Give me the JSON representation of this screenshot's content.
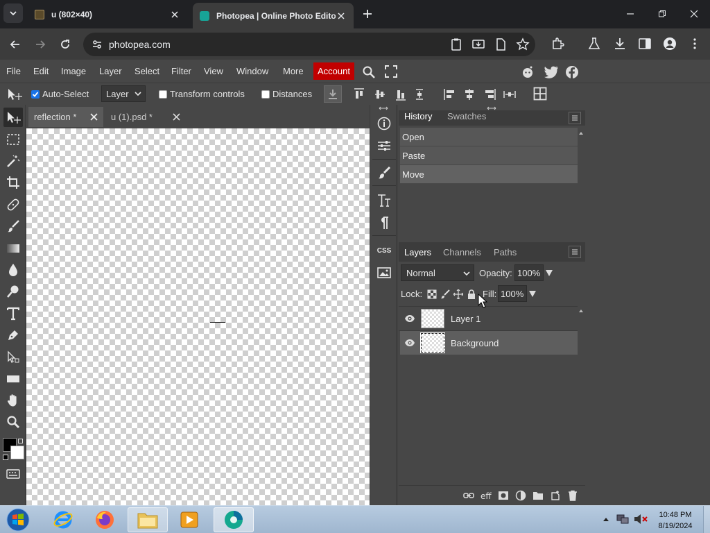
{
  "browser": {
    "tabs": [
      {
        "title": "u (802×40)",
        "active": false
      },
      {
        "title": "Photopea | Online Photo Editor",
        "active": true
      }
    ],
    "url": "photopea.com"
  },
  "menu": {
    "items": [
      "File",
      "Edit",
      "Image",
      "Layer",
      "Select",
      "Filter",
      "View",
      "Window",
      "More"
    ],
    "account": "Account"
  },
  "options": {
    "auto_select": "Auto-Select",
    "layer_select": "Layer",
    "transform_controls": "Transform controls",
    "distances": "Distances"
  },
  "documents": [
    {
      "title": "reflection *",
      "active": true
    },
    {
      "title": "u (1).psd *",
      "active": false
    }
  ],
  "history": {
    "tabs": [
      "History",
      "Swatches"
    ],
    "steps": [
      "Open",
      "Paste",
      "Move"
    ]
  },
  "layers_panel": {
    "tabs": [
      "Layers",
      "Channels",
      "Paths"
    ],
    "blend_mode": "Normal",
    "opacity_label": "Opacity:",
    "opacity_value": "100%",
    "lock_label": "Lock:",
    "fill_label": "Fill:",
    "fill_value": "100%",
    "layers": [
      {
        "name": "Layer 1",
        "selected": false
      },
      {
        "name": "Background",
        "selected": true
      }
    ]
  },
  "side_icons": {
    "css": "CSS"
  },
  "taskbar": {
    "time": "10:48 PM",
    "date": "8/19/2024"
  },
  "colors": {
    "account_red": "#c10000",
    "panel_bg": "#474747",
    "chrome_dark": "#202124"
  }
}
